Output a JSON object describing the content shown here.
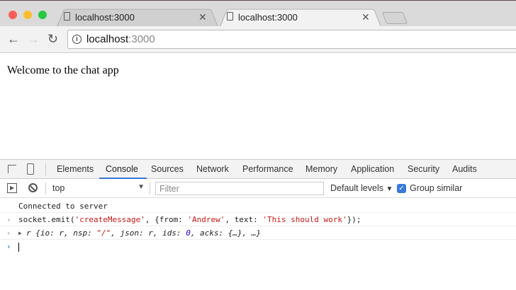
{
  "tabs": [
    {
      "title": "localhost:3000",
      "active": false
    },
    {
      "title": "localhost:3000",
      "active": true
    }
  ],
  "address": {
    "host": "localhost",
    "port": ":3000"
  },
  "page": {
    "welcome": "Welcome to the chat app"
  },
  "devtools": {
    "tabs": [
      "Elements",
      "Console",
      "Sources",
      "Network",
      "Performance",
      "Memory",
      "Application",
      "Security",
      "Audits"
    ],
    "active_tab": "Console",
    "context": "top",
    "filter_placeholder": "Filter",
    "levels": "Default levels",
    "group_similar": "Group similar",
    "group_similar_checked": true
  },
  "console": {
    "log": "Connected to server",
    "input": {
      "p1": "socket.emit(",
      "s1": "'createMessage'",
      "p2": ", {from: ",
      "s2": "'Andrew'",
      "p3": ", text: ",
      "s3": "'This should work'",
      "p4": "});"
    },
    "result": {
      "p1": "r {io: r, nsp: ",
      "s1": "\"/\"",
      "p2": ", json: r, ids: ",
      "n1": "0",
      "p3": ", acks: {…}, …}"
    }
  }
}
